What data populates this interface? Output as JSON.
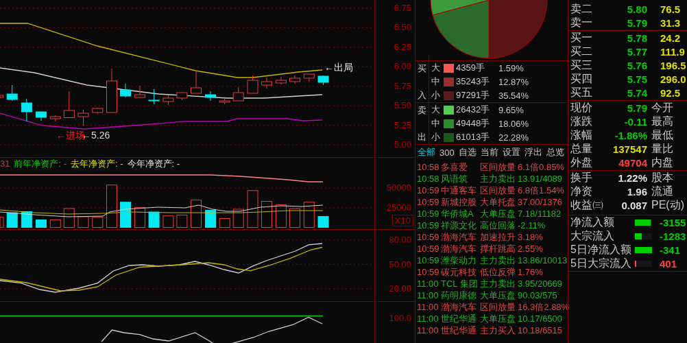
{
  "price_chart": {
    "annotations": [
      {
        "text": "←进场",
        "color": "#ff2020"
      },
      {
        "text": "←5.26",
        "color": "#d8d8d8"
      },
      {
        "text": "←出局",
        "color": "#ececec"
      }
    ],
    "yticks": [
      "6.75",
      "6.50",
      "6.25",
      "6.00",
      "5.75",
      "5.50",
      "5.25",
      "5.00"
    ]
  },
  "volume_chart": {
    "header": [
      {
        "text": "31",
        "color": "#a04848"
      },
      {
        "text": "前年净资产: -",
        "color": "#00d000"
      },
      {
        "text": "去年净资产: -",
        "color": "#e0e000"
      },
      {
        "text": "今年净资产: -",
        "color": "#e6e6e6"
      }
    ],
    "yticks": [
      "50000",
      "25000"
    ],
    "unit": "X10"
  },
  "indicator_chart": {
    "yticks": [
      "80.00",
      "50.00",
      "20.00"
    ]
  },
  "lower_chart": {
    "yticks": [
      "100.0"
    ]
  },
  "order_flow": [
    {
      "side": "买入",
      "rows": [
        {
          "size": "大",
          "amount": "4359手",
          "share": "1.59%",
          "color": "#ff5252"
        },
        {
          "size": "中",
          "amount": "35243手",
          "share": "12.87%",
          "color": "#9a2e2e"
        },
        {
          "size": "小",
          "amount": "97291手",
          "share": "35.54%",
          "color": "#581c1c"
        }
      ]
    },
    {
      "side": "卖出",
      "rows": [
        {
          "size": "大",
          "amount": "26432手",
          "share": "9.65%",
          "color": "#55c855"
        },
        {
          "size": "中",
          "amount": "49448手",
          "share": "18.06%",
          "color": "#2e8a2e"
        },
        {
          "size": "小",
          "amount": "61013手",
          "share": "22.28%",
          "color": "#1e561e"
        }
      ]
    }
  ],
  "tabs": [
    {
      "label": "全部",
      "selected": true
    },
    {
      "label": "300",
      "selected": false
    },
    {
      "label": "自选",
      "selected": false
    },
    {
      "label": "当前",
      "selected": false
    },
    {
      "label": "设置",
      "selected": false
    },
    {
      "label": "浮出",
      "selected": false
    },
    {
      "label": "总览",
      "selected": false
    }
  ],
  "news": [
    {
      "time": "10:58",
      "name": "多喜爱",
      "event": "区间放量",
      "value": "6.1倍0.85%",
      "color": "#e04848"
    },
    {
      "time": "10:58",
      "name": "风语筑",
      "event": "主力卖出",
      "value": "13.91/4089",
      "color": "#22b422"
    },
    {
      "time": "10:59",
      "name": "中通客车",
      "event": "区间放量",
      "value": "6.8倍1.54%",
      "color": "#e04848"
    },
    {
      "time": "10:59",
      "name": "新城控股",
      "event": "大单托盘",
      "value": "37.00/1376",
      "color": "#e04848"
    },
    {
      "time": "10:59",
      "name": "华侨城A",
      "event": "大单压盘",
      "value": "7.18/11182",
      "color": "#22b422"
    },
    {
      "time": "10:59",
      "name": "祥源文化",
      "event": "高位回落",
      "value": "-2.11%",
      "color": "#22b422"
    },
    {
      "time": "10:59",
      "name": "渤海汽车",
      "event": "加速拉升",
      "value": "3.18%",
      "color": "#e04848"
    },
    {
      "time": "10:59",
      "name": "渤海汽车",
      "event": "撑杆跳高",
      "value": "2.55%",
      "color": "#e04848"
    },
    {
      "time": "10:59",
      "name": "潍柴动力",
      "event": "主力卖出",
      "value": "13.86/10013",
      "color": "#22b422"
    },
    {
      "time": "10:59",
      "name": "碳元科技",
      "event": "低位反弹",
      "value": "1.76%",
      "color": "#e04848"
    },
    {
      "time": "11:00",
      "name": "TCL 集团",
      "event": "主力卖出",
      "value": "3.95/20669",
      "color": "#22b422"
    },
    {
      "time": "11:00",
      "name": "药明康德",
      "event": "大单压盘",
      "value": "90.03/575",
      "color": "#22b422"
    },
    {
      "time": "11:00",
      "name": "渤海汽车",
      "event": "区间放量",
      "value": "16.3倍2.88%",
      "color": "#e04848"
    },
    {
      "time": "11:00",
      "name": "世纪华通",
      "event": "大单压盘",
      "value": "10.17/6500",
      "color": "#22b422"
    },
    {
      "time": "11:00",
      "name": "世纪华通",
      "event": "主力买入",
      "value": "10.18/6515",
      "color": "#e04848"
    }
  ],
  "order_book": {
    "asks": [
      {
        "label": "卖二",
        "price": "5.80",
        "volume": "76.5"
      },
      {
        "label": "卖一",
        "price": "5.79",
        "volume": "31.3"
      }
    ],
    "bids": [
      {
        "label": "买一",
        "price": "5.78",
        "volume": "24.2"
      },
      {
        "label": "买二",
        "price": "5.77",
        "volume": "111.9"
      },
      {
        "label": "买三",
        "price": "5.76",
        "volume": "196.5"
      },
      {
        "label": "买四",
        "price": "5.75",
        "volume": "296.0"
      },
      {
        "label": "买五",
        "price": "5.74",
        "volume": "92.5"
      }
    ]
  },
  "quote": [
    {
      "label": "现价",
      "value": "5.79",
      "color": "#00d000",
      "label2": "今开"
    },
    {
      "label": "涨跌",
      "value": "-0.11",
      "color": "#00d000",
      "label2": "最高"
    },
    {
      "label": "涨幅",
      "value": "-1.86%",
      "color": "#00d000",
      "label2": "最低"
    },
    {
      "label": "总量",
      "value": "137547",
      "color": "#e0e000",
      "label2": "量比"
    },
    {
      "label": "外盘",
      "value": "49704",
      "color": "#ff4040",
      "label2": "内盘"
    }
  ],
  "stats": [
    {
      "label": "换手",
      "value": "1.22%",
      "label2": "股本"
    },
    {
      "label": "净资",
      "value": "1.96",
      "label2": "流通"
    },
    {
      "label": "收益㈢",
      "value": "0.087",
      "label2": "PE(动)"
    }
  ],
  "fund_flows": [
    {
      "label": "净流入额",
      "level": 0.92,
      "value": "-3155",
      "color": "#00d000"
    },
    {
      "label": "大宗流入",
      "level": 0.4,
      "value": "-1283",
      "color": "#00d000"
    },
    {
      "label": "5日净流入额",
      "level": 1,
      "value": "-341",
      "color": "#00d000"
    },
    {
      "label": "5日大宗流入",
      "level": 0.08,
      "value": "401",
      "color": "#ff4040"
    }
  ]
}
